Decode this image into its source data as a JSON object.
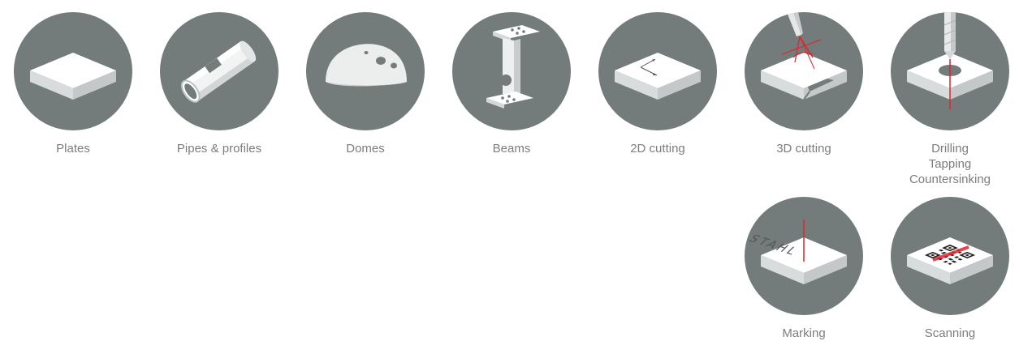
{
  "items": [
    {
      "id": "plates",
      "icon": "plate-icon",
      "lines": [
        "Plates"
      ]
    },
    {
      "id": "pipes",
      "icon": "pipe-icon",
      "lines": [
        "Pipes & profiles"
      ]
    },
    {
      "id": "domes",
      "icon": "dome-icon",
      "lines": [
        "Domes"
      ]
    },
    {
      "id": "beams",
      "icon": "beam-icon",
      "lines": [
        "Beams"
      ]
    },
    {
      "id": "cutting-2d",
      "icon": "cutting-2d-icon",
      "lines": [
        "2D cutting"
      ]
    },
    {
      "id": "cutting-3d",
      "icon": "cutting-3d-icon",
      "lines": [
        "3D cutting"
      ]
    },
    {
      "id": "drilling",
      "icon": "drill-icon",
      "lines": [
        "Drilling",
        "Tapping",
        "Countersinking"
      ]
    },
    {
      "id": "marking",
      "icon": "marking-icon",
      "lines": [
        "Marking"
      ],
      "engraving": "STAHL"
    },
    {
      "id": "scanning",
      "icon": "qr-code-icon",
      "lines": [
        "Scanning"
      ]
    }
  ],
  "colors": {
    "circle": "#737b7b",
    "label": "#7d7d7d",
    "accent": "#e0242b"
  }
}
